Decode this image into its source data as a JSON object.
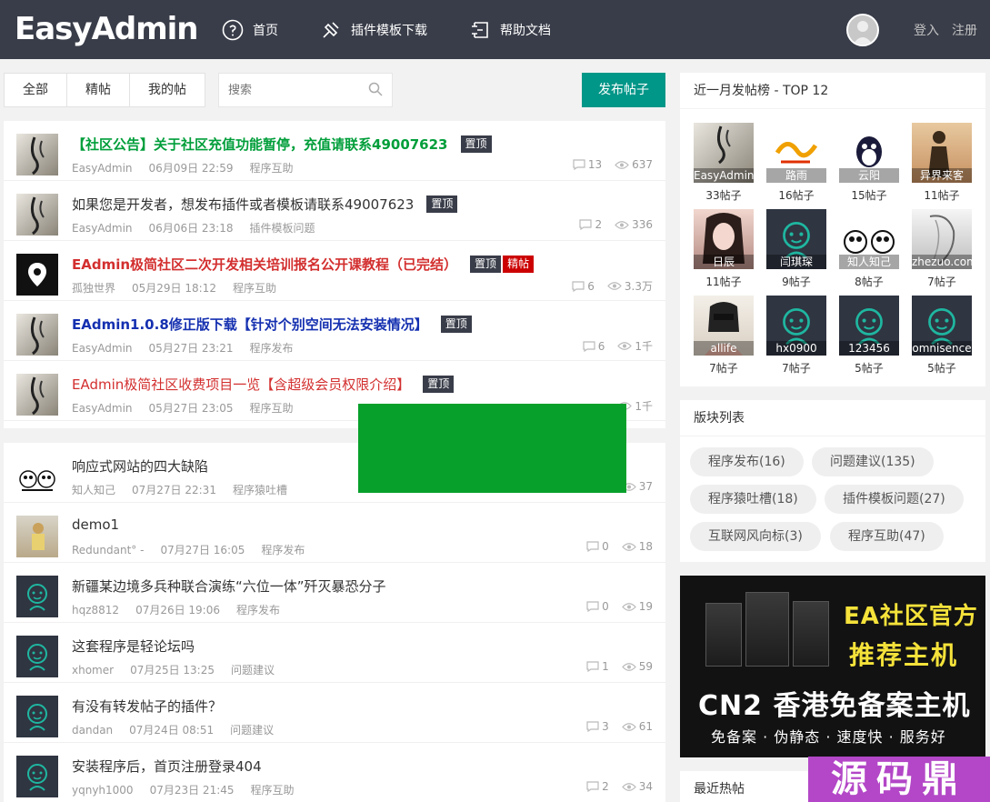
{
  "header": {
    "logo": "EasyAdmin",
    "nav": [
      {
        "label": "首页",
        "icon": "compass-icon"
      },
      {
        "label": "插件模板下载",
        "icon": "puzzle-icon"
      },
      {
        "label": "帮助文档",
        "icon": "document-icon"
      }
    ],
    "login": "登入",
    "register": "注册"
  },
  "filter": {
    "tabs": [
      "全部",
      "精帖",
      "我的帖"
    ],
    "search_placeholder": "搜索",
    "post_button": "发布帖子"
  },
  "top_posts": [
    {
      "title": "【社区公告】关于社区充值功能暂停，充值请联系49007623",
      "style": "green",
      "badges": [
        "置顶"
      ],
      "author": "EasyAdmin",
      "time": "06月09日 22:59",
      "category": "程序互助",
      "comments": "13",
      "views": "637"
    },
    {
      "title": "如果您是开发者，想发布插件或者模板请联系49007623",
      "style": "normal",
      "badges": [
        "置顶"
      ],
      "author": "EasyAdmin",
      "time": "06月06日 23:18",
      "category": "插件模板问题",
      "comments": "2",
      "views": "336"
    },
    {
      "title": "EAdmin极简社区二次开发相关培训报名公开课教程（已完结）",
      "style": "red",
      "badges": [
        "置顶",
        "精帖"
      ],
      "author": "孤独世界",
      "time": "05月29日 18:12",
      "category": "程序互助",
      "comments": "6",
      "views": "3.3万"
    },
    {
      "title": "EAdmin1.0.8修正版下载【针对个别空间无法安装情况】",
      "style": "blue",
      "badges": [
        "置顶"
      ],
      "author": "EasyAdmin",
      "time": "05月27日 23:21",
      "category": "程序发布",
      "comments": "6",
      "views": "1千"
    },
    {
      "title": "EAdmin极简社区收费项目一览【含超级会员权限介绍】",
      "style": "red-thin",
      "badges": [
        "置顶"
      ],
      "author": "EasyAdmin",
      "time": "05月27日 23:05",
      "category": "程序互助",
      "comments": "",
      "views": "1千"
    }
  ],
  "posts": [
    {
      "title": "响应式网站的四大缺陷",
      "author": "知人知己",
      "time": "07月27日 22:31",
      "category": "程序猿吐槽",
      "comments": "",
      "views": "37"
    },
    {
      "title": "demo1",
      "author": "Redundant° -",
      "time": "07月27日 16:05",
      "category": "程序发布",
      "comments": "0",
      "views": "18"
    },
    {
      "title": "新疆某边境多兵种联合演练“六位一体”歼灭暴恐分子",
      "author": "hqz8812",
      "time": "07月26日 19:06",
      "category": "程序发布",
      "comments": "0",
      "views": "19"
    },
    {
      "title": "这套程序是轻论坛吗",
      "author": "xhomer",
      "time": "07月25日 13:25",
      "category": "问题建议",
      "comments": "1",
      "views": "59"
    },
    {
      "title": "有没有转发帖子的插件？",
      "author": "dandan",
      "time": "07月24日 08:51",
      "category": "问题建议",
      "comments": "3",
      "views": "61"
    },
    {
      "title": "安装程序后，首页注册登录404",
      "author": "yqnyh1000",
      "time": "07月23日 21:45",
      "category": "程序互助",
      "comments": "2",
      "views": "34"
    }
  ],
  "top12": {
    "title": "近一月发帖榜 - TOP 12",
    "users": [
      {
        "name": "EasyAdmin",
        "count": "33帖子"
      },
      {
        "name": "路雨",
        "count": "16帖子"
      },
      {
        "name": "云阳",
        "count": "15帖子"
      },
      {
        "name": "异界来客",
        "count": "11帖子"
      },
      {
        "name": "日辰",
        "count": "11帖子"
      },
      {
        "name": "闫琪琛",
        "count": "9帖子"
      },
      {
        "name": "知人知己",
        "count": "8帖子"
      },
      {
        "name": "zhezuo.com",
        "count": "7帖子"
      },
      {
        "name": "allife",
        "count": "7帖子"
      },
      {
        "name": "hx0900",
        "count": "7帖子"
      },
      {
        "name": "123456",
        "count": "5帖子"
      },
      {
        "name": "omnisence",
        "count": "5帖子"
      }
    ]
  },
  "boards": {
    "title": "版块列表",
    "items": [
      "程序发布(16)",
      "问题建议(135)",
      "程序猿吐槽(18)",
      "插件模板问题(27)",
      "互联网风向标(3)",
      "程序互助(47)"
    ]
  },
  "ad": {
    "line1": "EA社区官方",
    "line2": "推荐主机",
    "line3": "CN2 香港免备案主机",
    "line4": "免备案 · 伪静态 · 速度快 · 服务好"
  },
  "hot": {
    "title": "最近热帖"
  },
  "watermark": "源码鼎"
}
